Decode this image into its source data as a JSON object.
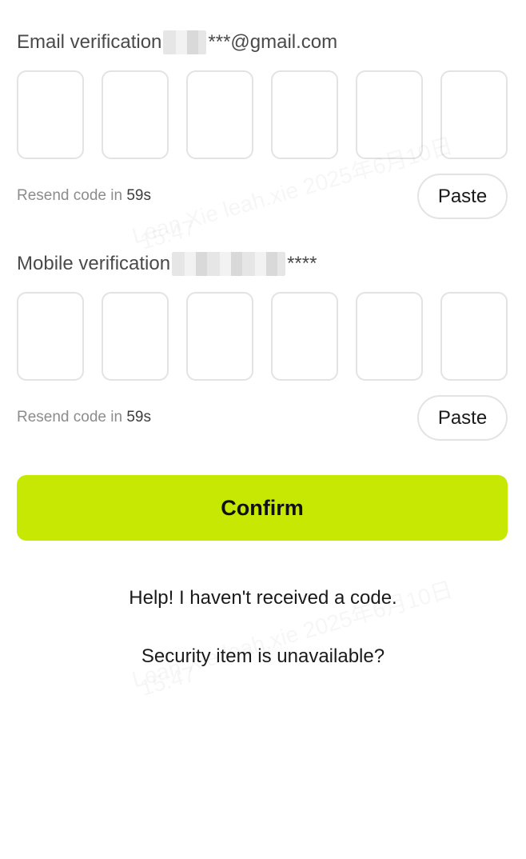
{
  "email_section": {
    "title": "Email verification",
    "masked_suffix": "***@gmail.com",
    "resend_prefix": "Resend code in ",
    "resend_count": "59s",
    "paste_label": "Paste"
  },
  "mobile_section": {
    "title": "Mobile verification",
    "masked_suffix": "****",
    "resend_prefix": "Resend code in ",
    "resend_count": "59s",
    "paste_label": "Paste"
  },
  "confirm_label": "Confirm",
  "help_link": "Help! I haven't received a code.",
  "security_link": "Security item is unavailable?",
  "watermark": {
    "line1": "Lean Xie leah.xie 2025年6月10日",
    "line2": "15:47"
  },
  "colors": {
    "accent": "#c7e802",
    "box_border": "#e3e3e3"
  }
}
